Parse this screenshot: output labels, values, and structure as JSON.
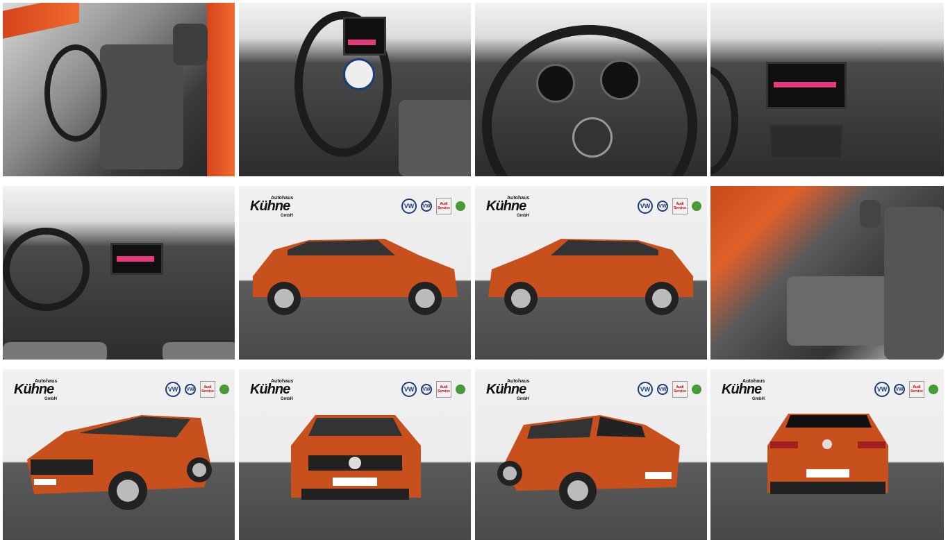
{
  "gallery": {
    "dealer_logo": {
      "word": "Kühne",
      "small": "Autohaus",
      "gmbh": "GmbH"
    },
    "brand_badge": "VW",
    "audi_label": "Audi Service",
    "tiles": [
      {
        "kind": "interior-front-door"
      },
      {
        "kind": "interior-steering-wheel"
      },
      {
        "kind": "interior-cockpit"
      },
      {
        "kind": "interior-infotainment"
      },
      {
        "kind": "interior-dashboard"
      },
      {
        "kind": "exterior-side-right"
      },
      {
        "kind": "exterior-side-left"
      },
      {
        "kind": "interior-rear-seats"
      },
      {
        "kind": "exterior-front-three-quarter"
      },
      {
        "kind": "exterior-front"
      },
      {
        "kind": "exterior-rear-three-quarter"
      },
      {
        "kind": "exterior-rear"
      }
    ]
  },
  "colors": {
    "car_body": "#c8501c",
    "floor": "#4a4a4a",
    "backdrop": "#ececec"
  }
}
